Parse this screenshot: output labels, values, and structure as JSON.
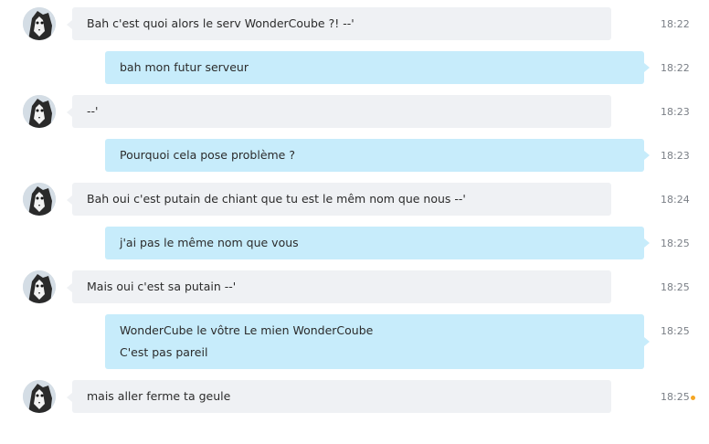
{
  "conversation": {
    "messages": [
      {
        "direction": "in",
        "lines": [
          "Bah c'est quoi alors le serv WonderCoube ?! --'"
        ],
        "time": "18:22"
      },
      {
        "direction": "out",
        "lines": [
          "bah mon futur serveur"
        ],
        "time": "18:22"
      },
      {
        "direction": "in",
        "lines": [
          "--'"
        ],
        "time": "18:23"
      },
      {
        "direction": "out",
        "lines": [
          "Pourquoi cela pose problème ?"
        ],
        "time": "18:23"
      },
      {
        "direction": "in",
        "lines": [
          "Bah oui c'est putain de chiant que tu est le mêm nom que nous --'"
        ],
        "time": "18:24"
      },
      {
        "direction": "out",
        "lines": [
          "j'ai pas le même nom que vous"
        ],
        "time": "18:25"
      },
      {
        "direction": "in",
        "lines": [
          "Mais oui c'est sa putain --'"
        ],
        "time": "18:25"
      },
      {
        "direction": "out",
        "lines": [
          "WonderCube le vôtre Le mien WonderCoube",
          "C'est pas pareil"
        ],
        "time": "18:25"
      },
      {
        "direction": "in",
        "lines": [
          "mais aller ferme ta geule"
        ],
        "time": "18:25",
        "unread_indicator": true
      }
    ]
  },
  "colors": {
    "incoming_bubble": "#eff1f4",
    "outgoing_bubble": "#c7ecfb",
    "timestamp": "#7a7f86",
    "unread_dot": "#f5a623"
  },
  "icons": {
    "avatar": "husky-avatar-icon",
    "unread": "unread-dot-icon"
  }
}
